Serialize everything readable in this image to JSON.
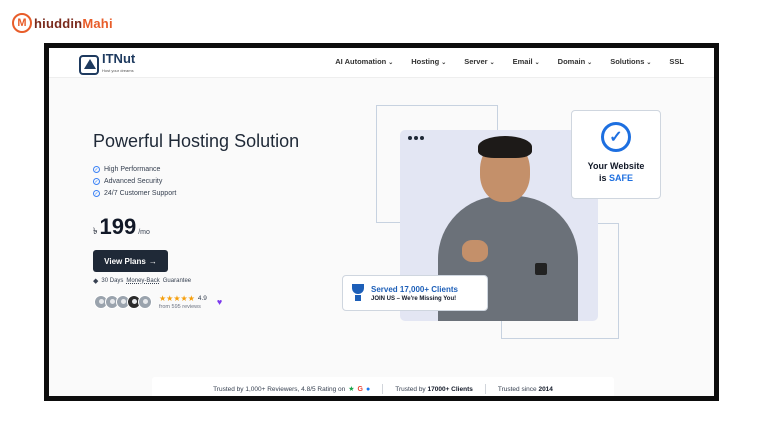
{
  "watermark": {
    "icon": "M",
    "prefix": "hiuddin",
    "suffix": "Mahi"
  },
  "logo": {
    "name": "ITNut",
    "tagline": "Host your dreams"
  },
  "nav": {
    "items": [
      {
        "label": "AI Automation"
      },
      {
        "label": "Hosting"
      },
      {
        "label": "Server"
      },
      {
        "label": "Email"
      },
      {
        "label": "Domain"
      },
      {
        "label": "Solutions"
      },
      {
        "label": "SSL"
      }
    ],
    "chevron": "⌄"
  },
  "hero": {
    "headline": "Powerful Hosting Solution",
    "features": [
      "High Performance",
      "Advanced Security",
      "24/7 Customer Support"
    ],
    "price": {
      "currency": "৳",
      "amount": "199",
      "period": "/mo"
    },
    "cta_label": "View Plans",
    "cta_arrow": "→",
    "guarantee_prefix": "30 Days ",
    "guarantee_link": "Money-Back",
    "guarantee_suffix": " Guarantee",
    "rating": {
      "stars": "★★★★★",
      "score": "4.9",
      "count_text": "from 595 reviews"
    }
  },
  "safe_card": {
    "check": "✓",
    "line1": "Your Website",
    "line2_prefix": "is ",
    "line2_highlight": "SAFE"
  },
  "served_card": {
    "title": "Served 17,000+ Clients",
    "subtitle": "JOIN US – We're Missing You!"
  },
  "trust": {
    "reviewers_text": "Trusted by 1,000+ Reviewers, 4.8/5 Rating on",
    "clients_prefix": "Trusted by ",
    "clients_value": "17000+ Clients",
    "since_prefix": "Trusted since ",
    "since_value": "2014"
  },
  "colors": {
    "accent": "#1d6fe0",
    "dark_button": "#1f2937",
    "star": "#f59e0b",
    "heart": "#7c3aed",
    "watermark": "#e85d2a"
  }
}
